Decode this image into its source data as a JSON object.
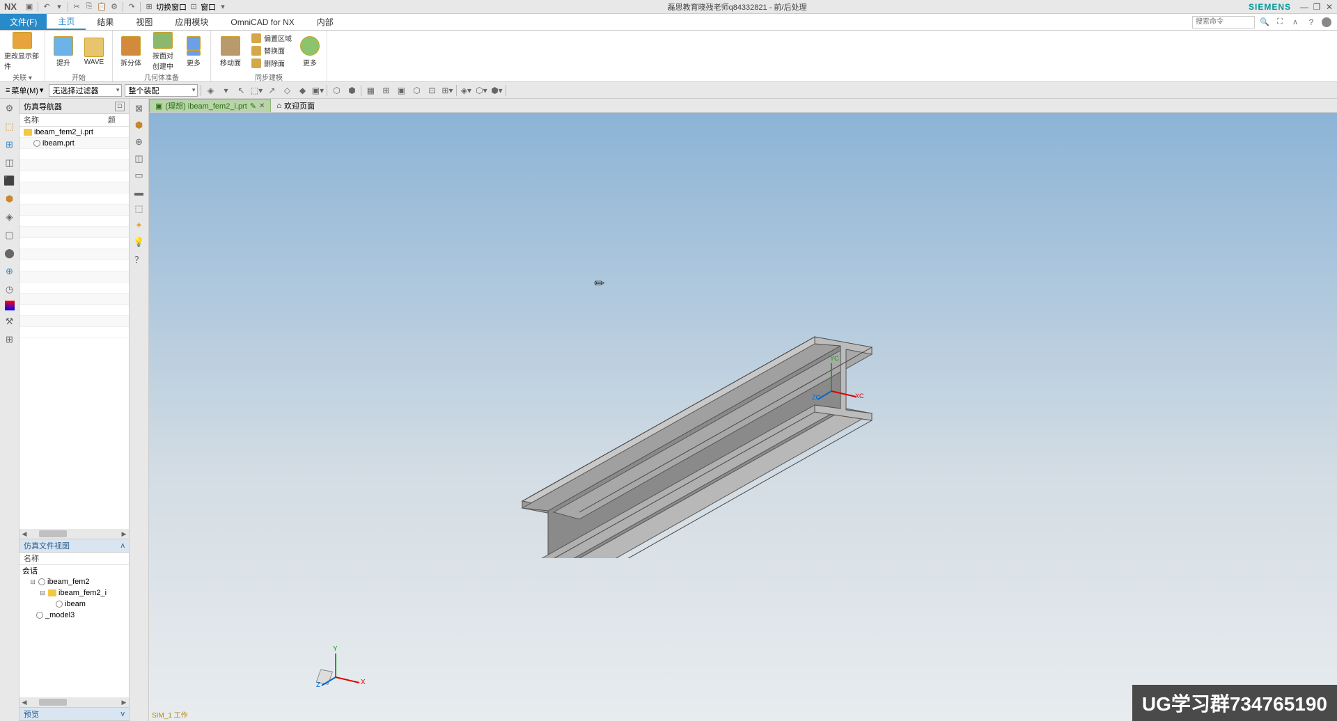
{
  "title_bar": {
    "nx": "NX",
    "switch_window": "切换窗口",
    "window": "窗口",
    "center_text": "磊思教育晓残老师q84332821 - 前/后处理",
    "siemens": "SIEMENS"
  },
  "menu": {
    "file": "文件(F)",
    "tabs": [
      "主页",
      "结果",
      "视图",
      "应用模块",
      "OmniCAD for NX",
      "内部"
    ],
    "search_placeholder": "搜索命令"
  },
  "ribbon": {
    "group1": {
      "btn1": "更改显示部件",
      "label": "关联"
    },
    "group2": {
      "btn1": "提升",
      "btn2": "WAVE",
      "label": "开始"
    },
    "group3": {
      "btn1": "拆分体",
      "btn2": "按面对\n创建中",
      "btn3": "更多",
      "label": "几何体准备"
    },
    "group4": {
      "btn1": "移动面",
      "small1": "偏置区域",
      "small2": "替换面",
      "small3": "删除面",
      "btn2": "更多",
      "label": "同步建模"
    }
  },
  "filter_bar": {
    "menu": "菜单(M)",
    "filter1": "无选择过滤器",
    "filter2": "整个装配"
  },
  "nav_panel": {
    "title": "仿真导航器",
    "col1": "名称",
    "col2": "颜",
    "tree": [
      {
        "name": "ibeam_fem2_i.prt",
        "indent": 0,
        "type": "folder"
      },
      {
        "name": "ibeam.prt",
        "indent": 1,
        "type": "part"
      }
    ]
  },
  "file_view": {
    "title": "仿真文件视图",
    "col1": "名称",
    "session": "会话",
    "tree": [
      {
        "name": "ibeam_fem2",
        "indent": 1,
        "expand": "⊟"
      },
      {
        "name": "ibeam_fem2_i",
        "indent": 2,
        "expand": "⊟",
        "folder": true
      },
      {
        "name": "ibeam",
        "indent": 3,
        "expand": ""
      },
      {
        "name": "_model3",
        "indent": 1,
        "expand": ""
      }
    ],
    "preview_title": "预览"
  },
  "tabs": {
    "active": "(理想) ibeam_fem2_i.prt",
    "welcome": "欢迎页面"
  },
  "viewport": {
    "status": "SIM_1 工作",
    "axis_x": "XC",
    "axis_y": "YC",
    "axis_z": "ZC",
    "triad_x": "X",
    "triad_y": "Y",
    "triad_z": "Z"
  },
  "watermark": "UG学习群734765190"
}
